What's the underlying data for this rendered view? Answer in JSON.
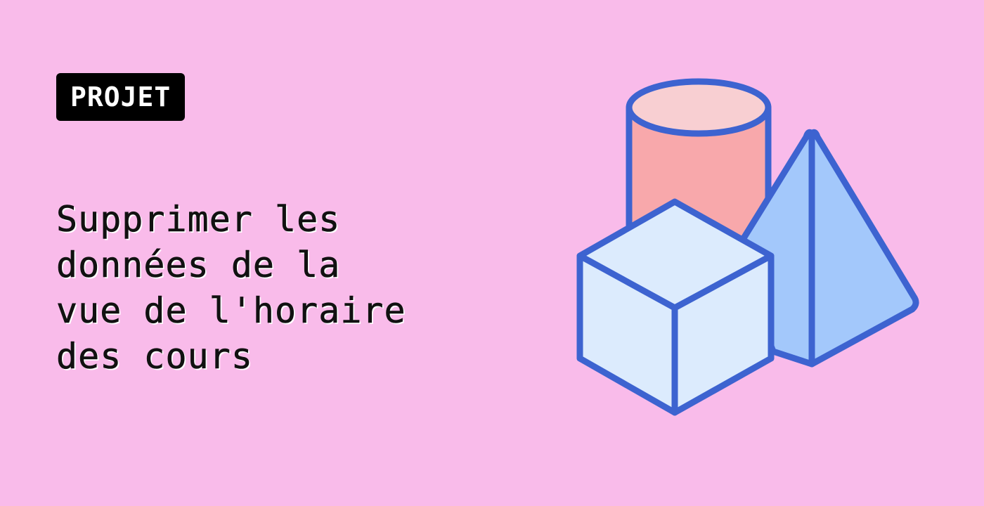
{
  "badge": {
    "label": "PROJET"
  },
  "title": {
    "lines": [
      "Supprimer les",
      "données de la",
      "vue de l'horaire",
      "des cours"
    ]
  },
  "colors": {
    "background": "#f9bbea",
    "badge_bg": "#000000",
    "badge_text": "#ffffff",
    "outline": "#3d63d0",
    "cylinder_top": "#f8cfd2",
    "cylinder_body": "#f8a8ab",
    "pyramid": "#a3c8fb",
    "cube": "#dcebfd"
  },
  "illustration": {
    "shapes": [
      "cylinder-icon",
      "pyramid-icon",
      "cube-icon"
    ]
  }
}
